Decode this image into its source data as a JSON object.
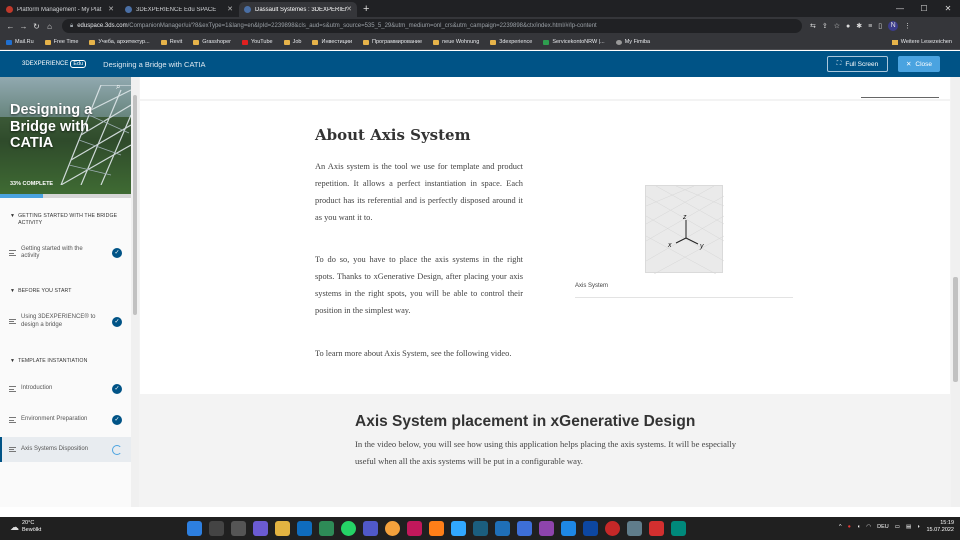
{
  "browser": {
    "tabs": [
      {
        "title": "Platform Management - My Plat",
        "color": "#c0392b",
        "active": false
      },
      {
        "title": "3DEXPERIENCE Edu SPACE",
        "color": "#4a6fa5",
        "active": false
      },
      {
        "title": "Dassault Systèmes : 3DEXPERIENC",
        "color": "#4a6fa5",
        "active": true
      }
    ],
    "new_tab": "+",
    "url_host": "eduspace.3ds.com",
    "url_rest": "/CompanionManager/ui/?8&exType=1&lang=en&lpId=2239898&cls_aud=s&utm_source=535_5_29&utm_medium=onl_crs&utm_campaign=2239898&ctx/index.html/#/lp-content",
    "profile_initial": "N",
    "bookmarks": [
      "Mail.Ru",
      "Free Time",
      "Учеба, архитектур...",
      "Revit",
      "Grasshoper",
      "YouTube",
      "Job",
      "Инвестиции",
      "Программирование",
      "neue Wohnung",
      "3dexperience",
      "ServicekontoNRW |...",
      "My Fimiba"
    ],
    "bookmarks_other": "Weitere Lesezeichen"
  },
  "header": {
    "brand": "3DEXPERIENCE",
    "brand_badge": "Edu",
    "course_title": "Designing a Bridge with CATIA",
    "full_screen_label": "Full Screen",
    "close_label": "Close"
  },
  "sidebar": {
    "course_name": "Designing a Bridge with CATIA",
    "progress_label": "33% COMPLETE",
    "progress": 0.33,
    "sections": [
      {
        "title": "GETTING STARTED WITH THE BRIDGE ACTIVITY",
        "lessons": [
          {
            "title": "Getting started with the activity",
            "status": "done"
          }
        ]
      },
      {
        "title": "BEFORE YOU START",
        "lessons": [
          {
            "title": "Using 3DEXPERIENCE® to design a bridge",
            "status": "done"
          }
        ]
      },
      {
        "title": "TEMPLATE INSTANTIATION",
        "lessons": [
          {
            "title": "Introduction",
            "status": "done"
          },
          {
            "title": "Environment Preparation",
            "status": "done"
          },
          {
            "title": "Axis Systems Disposition",
            "status": "in-progress"
          }
        ]
      }
    ]
  },
  "content": {
    "heading": "About Axis System",
    "p1": "An Axis system is the tool we use for template and product repetition. It allows a perfect instantiation in space. Each product has its referential and is perfectly disposed around it as you want it to.",
    "p2": "To do so, you have to place the axis systems in the right spots. Thanks to xGenerative Design, after placing your axis systems in the right spots, you will be able to control their position in the simplest way.",
    "p3": "To learn more about Axis System, see the following video.",
    "image_caption": "Axis System",
    "axis_labels": {
      "z": "z",
      "x": "x",
      "y": "y"
    },
    "video_heading": "Axis System placement in xGenerative Design",
    "video_text": "In the video below, you will see how using this application helps placing the axis systems. It will be especially useful when all the axis systems will be put in a configurable way."
  },
  "taskbar": {
    "temperature": "20°C",
    "weather": "Bewölkt",
    "language": "DEU",
    "time": "15:19",
    "date": "15.07.2022"
  }
}
